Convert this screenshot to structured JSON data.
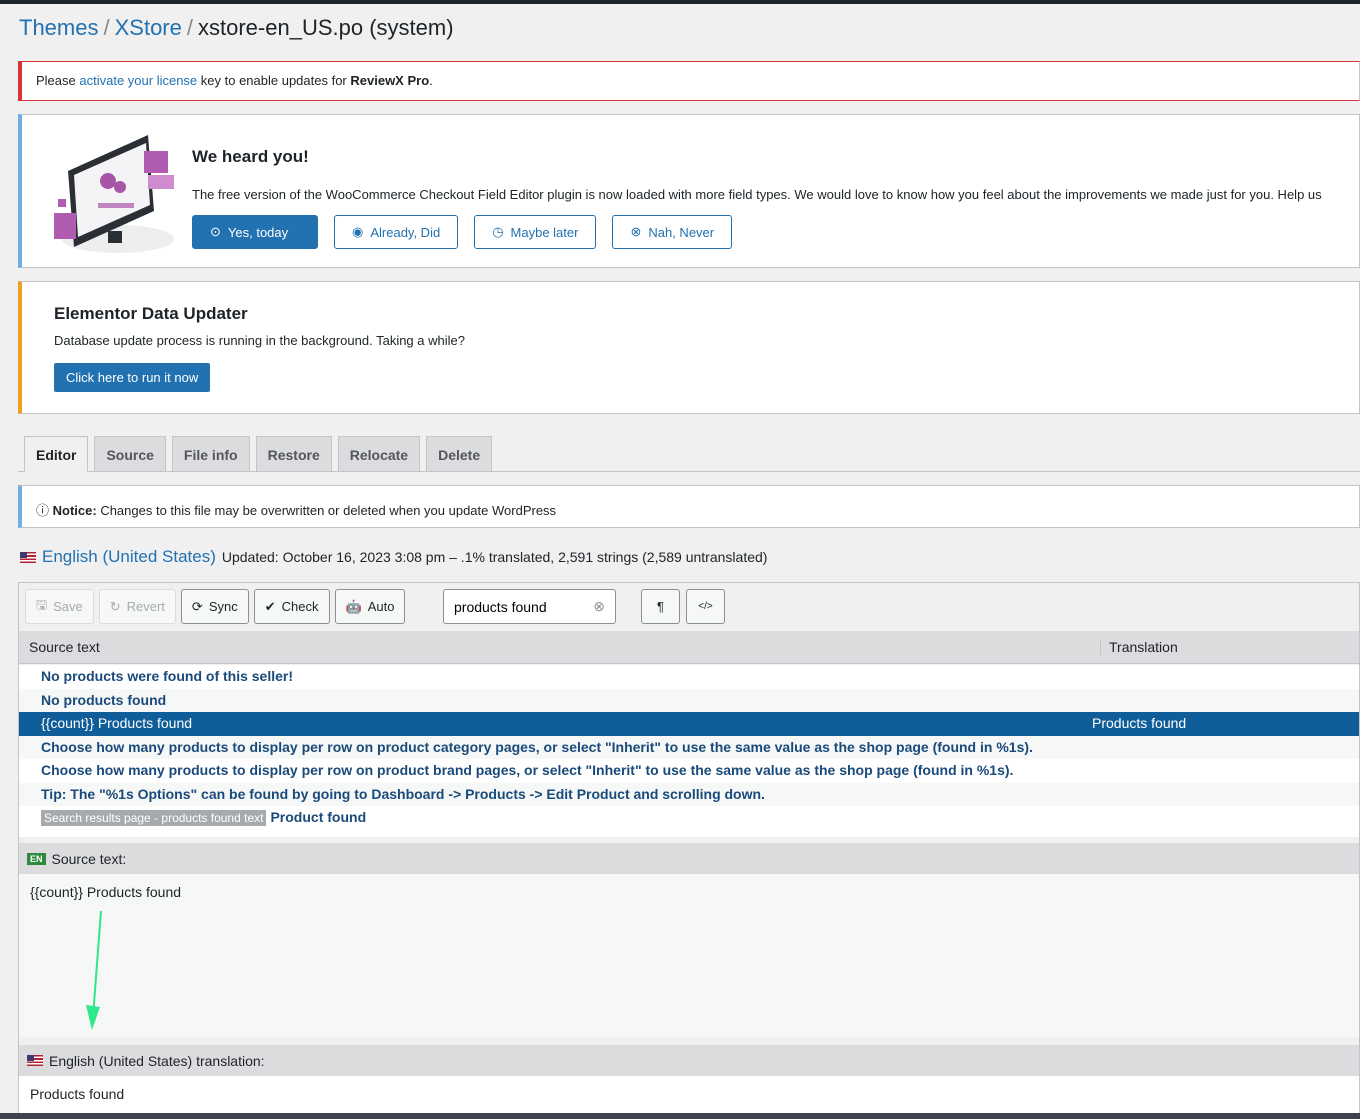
{
  "breadcrumb": {
    "items": [
      "Themes",
      "XStore"
    ],
    "current": "xstore-en_US.po (system)"
  },
  "license_notice": {
    "prefix": "Please ",
    "link": "activate your license",
    "middle": " key to enable updates for ",
    "product": "ReviewX Pro",
    "suffix": "."
  },
  "heard_notice": {
    "title": "We heard you!",
    "text": "The free version of the WooCommerce Checkout Field Editor plugin is now loaded with more field types. We would love to know how you feel about the improvements we made just for you. Help us",
    "buttons": [
      {
        "label": "Yes, today",
        "icon": "check-circle-icon"
      },
      {
        "label": "Already, Did",
        "icon": "thumbs-up-icon"
      },
      {
        "label": "Maybe later",
        "icon": "clock-icon"
      },
      {
        "label": "Nah, Never",
        "icon": "x-circle-icon"
      }
    ]
  },
  "elementor_notice": {
    "title": "Elementor Data Updater",
    "text": "Database update process is running in the background. Taking a while?",
    "button": "Click here to run it now"
  },
  "tabs": [
    {
      "label": "Editor",
      "active": true
    },
    {
      "label": "Source"
    },
    {
      "label": "File info"
    },
    {
      "label": "Restore"
    },
    {
      "label": "Relocate"
    },
    {
      "label": "Delete"
    }
  ],
  "warning": {
    "label": "Notice:",
    "text": " Changes to this file may be overwritten or deleted when you update WordPress"
  },
  "language": {
    "name": "English (United States)",
    "meta": "Updated: October 16, 2023 3:08 pm – .1% translated, 2,591 strings (2,589 untranslated)"
  },
  "toolbar": {
    "save": "Save",
    "revert": "Revert",
    "sync": "Sync",
    "check": "Check",
    "auto": "Auto",
    "search_value": "products found",
    "pilcrow": "¶",
    "code": "</>"
  },
  "table": {
    "headers": [
      "Source text",
      "Translation"
    ],
    "rows": [
      {
        "source": "No products were found of this seller!",
        "translation": ""
      },
      {
        "source": "No products found",
        "translation": ""
      },
      {
        "source": "{{count}} Products found",
        "translation": "Products found",
        "selected": true
      },
      {
        "source": "Choose how many products to display per row on product category pages, or select \"Inherit\" to use the same value as the shop page (found in %1s).",
        "translation": ""
      },
      {
        "source": "Choose how many products to display per row on product brand pages, or select \"Inherit\" to use the same value as the shop page (found in %1s).",
        "translation": ""
      },
      {
        "source": "Tip: The \"%1s Options\" can be found by going to Dashboard -> Products -> Edit Product and scrolling down.",
        "translation": ""
      },
      {
        "context": "Search results page - products found text",
        "source": "Product found",
        "translation": ""
      }
    ]
  },
  "source_pane": {
    "badge": "EN",
    "label": "Source text:",
    "text": "{{count}} Products found"
  },
  "translation_pane": {
    "label": "English (United States) translation:",
    "text": "Products found"
  },
  "colors": {
    "accent": "#2271b1",
    "selected_row": "#0f5e99",
    "annotation_arrow": "#2ee88a"
  }
}
